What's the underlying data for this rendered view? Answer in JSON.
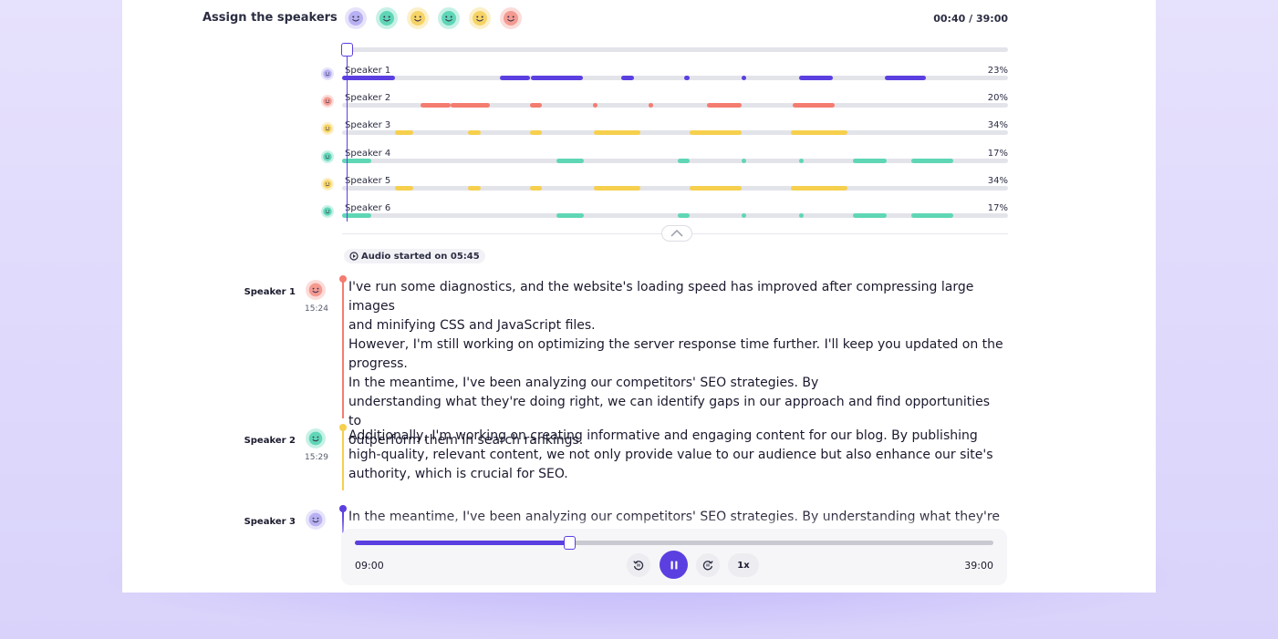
{
  "header": {
    "assign_title": "Assign the speakers",
    "current_time": "00:40",
    "separator": "/",
    "total_time": "39:00",
    "assign_faces": [
      {
        "icon": "smiley-face-icon",
        "color": "#b7b0f2"
      },
      {
        "icon": "smiley-face-icon",
        "color": "#5fd6b6"
      },
      {
        "icon": "smiley-face-icon",
        "color": "#f6d365"
      },
      {
        "icon": "smiley-face-icon",
        "color": "#5fd6b6"
      },
      {
        "icon": "smiley-face-icon",
        "color": "#f6d365"
      },
      {
        "icon": "smiley-face-icon",
        "color": "#f49a91"
      }
    ]
  },
  "timeline": {
    "playhead_fraction": 0.017,
    "speakers": [
      {
        "name": "Speaker 1",
        "percent": "23%",
        "color": "#5b3fe0",
        "face_color": "#b7b0f2",
        "segments": [
          [
            0.0,
            0.08
          ],
          [
            0.237,
            0.282
          ],
          [
            0.283,
            0.361
          ],
          [
            0.419,
            0.438
          ],
          [
            0.514,
            0.522
          ],
          [
            0.6,
            0.607
          ],
          [
            0.686,
            0.737
          ],
          [
            0.815,
            0.877
          ]
        ]
      },
      {
        "name": "Speaker 2",
        "percent": "20%",
        "color": "#f47c6f",
        "face_color": "#f49a91",
        "segments": [
          [
            0.118,
            0.163
          ],
          [
            0.163,
            0.222
          ],
          [
            0.282,
            0.3
          ],
          [
            0.377,
            0.384
          ],
          [
            0.46,
            0.467
          ],
          [
            0.548,
            0.6
          ],
          [
            0.677,
            0.74
          ]
        ]
      },
      {
        "name": "Speaker 3",
        "percent": "34%",
        "color": "#f6d04d",
        "face_color": "#f6d365",
        "segments": [
          [
            0.08,
            0.107
          ],
          [
            0.189,
            0.208
          ],
          [
            0.282,
            0.3
          ],
          [
            0.378,
            0.448
          ],
          [
            0.522,
            0.6
          ],
          [
            0.674,
            0.759
          ]
        ]
      },
      {
        "name": "Speaker 4",
        "percent": "17%",
        "color": "#5fd6b6",
        "face_color": "#5fd6b6",
        "segments": [
          [
            0.0,
            0.044
          ],
          [
            0.322,
            0.363
          ],
          [
            0.504,
            0.522
          ],
          [
            0.6,
            0.607
          ],
          [
            0.686,
            0.693
          ],
          [
            0.767,
            0.818
          ],
          [
            0.855,
            0.918
          ]
        ]
      },
      {
        "name": "Speaker 5",
        "percent": "34%",
        "color": "#f6d04d",
        "face_color": "#f6d365",
        "segments": [
          [
            0.08,
            0.107
          ],
          [
            0.189,
            0.208
          ],
          [
            0.282,
            0.3
          ],
          [
            0.378,
            0.448
          ],
          [
            0.522,
            0.6
          ],
          [
            0.674,
            0.759
          ]
        ]
      },
      {
        "name": "Speaker 6",
        "percent": "17%",
        "color": "#5fd6b6",
        "face_color": "#5fd6b6",
        "segments": [
          [
            0.0,
            0.044
          ],
          [
            0.322,
            0.363
          ],
          [
            0.504,
            0.522
          ],
          [
            0.6,
            0.607
          ],
          [
            0.686,
            0.693
          ],
          [
            0.767,
            0.818
          ],
          [
            0.855,
            0.918
          ]
        ]
      }
    ]
  },
  "audio_chip": {
    "icon": "play-circle-icon",
    "label": "Audio started on 05:45"
  },
  "transcript": [
    {
      "speaker": "Speaker 1",
      "time": "15:24",
      "color": "#f47c6f",
      "face_color": "#f49a91",
      "lines": [
        "I've run some diagnostics, and the website's loading speed has improved after compressing large images",
        "and minifying CSS and JavaScript files.",
        "However, I'm still working on optimizing the server response time further. I'll keep you updated on the",
        "progress.",
        "In the meantime, I've been analyzing our competitors' SEO strategies. By",
        "understanding what they're doing right, we can identify gaps in our approach and find opportunities to",
        "outperform them in search rankings."
      ]
    },
    {
      "speaker": "Speaker 2",
      "time": "15:29",
      "color": "#f6d04d",
      "face_color": "#5fd6b6",
      "lines": [
        "Additionally, I'm working on creating informative and engaging content for our blog. By publishing",
        "high-quality, relevant content, we not only provide value to our audience but also enhance our site's",
        "authority, which is crucial for SEO."
      ]
    },
    {
      "speaker": "Speaker 3",
      "time": "",
      "color": "#5b3fe0",
      "face_color": "#b7b0f2",
      "lines": [
        "In the meantime, I've been analyzing our competitors' SEO strategies. By understanding what they're"
      ]
    }
  ],
  "player": {
    "current_time": "09:00",
    "total_time": "39:00",
    "progress": 0.335,
    "rewind_icon": "rewind-icon",
    "play_pause_icon": "pause-icon",
    "forward_icon": "fast-forward-icon",
    "speed_label": "1x"
  },
  "colors": {
    "accent": "#5b3fe0",
    "track": "#e3e4ea"
  }
}
